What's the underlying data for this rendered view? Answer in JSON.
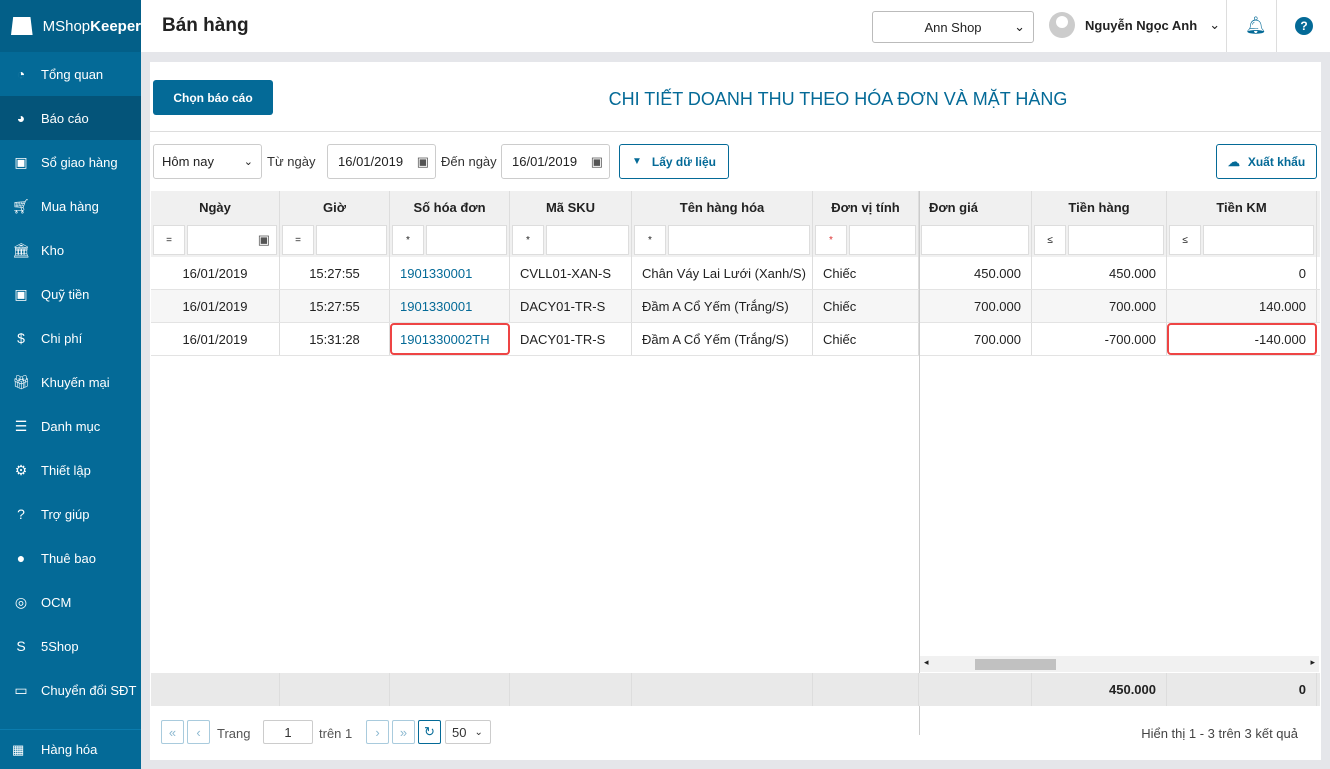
{
  "app": {
    "logo_light": "MShop",
    "logo_bold": "Keeper",
    "page_title": "Bán hàng"
  },
  "sidebar": {
    "items": [
      {
        "label": "Tổng quan",
        "icon": "dashboard-icon"
      },
      {
        "label": "Báo cáo",
        "icon": "pie-chart-icon",
        "active": true
      },
      {
        "label": "Sổ giao hàng",
        "icon": "truck-icon"
      },
      {
        "label": "Mua hàng",
        "icon": "cart-icon"
      },
      {
        "label": "Kho",
        "icon": "warehouse-icon"
      },
      {
        "label": "Quỹ tiền",
        "icon": "safe-icon"
      },
      {
        "label": "Chi phí",
        "icon": "money-icon"
      },
      {
        "label": "Khuyến mại",
        "icon": "gift-icon"
      },
      {
        "label": "Danh mục",
        "icon": "list-icon"
      },
      {
        "label": "Thiết lập",
        "icon": "gear-icon"
      },
      {
        "label": "Trợ giúp",
        "icon": "help-icon"
      },
      {
        "label": "Thuê bao",
        "icon": "user-icon"
      },
      {
        "label": "OCM",
        "icon": "ocm-icon"
      },
      {
        "label": "5Shop",
        "icon": "5shop-icon"
      },
      {
        "label": "Chuyển đổi SĐT",
        "icon": "phone-convert-icon"
      }
    ],
    "bottom": "Hàng hóa"
  },
  "header": {
    "shop": "Ann Shop",
    "user": "Nguyễn Ngọc Anh"
  },
  "report": {
    "choose_label": "Chọn báo cáo",
    "title": "CHI TIẾT DOANH THU THEO HÓA ĐƠN VÀ MẶT HÀNG",
    "period": "Hôm nay",
    "from_label": "Từ ngày",
    "from": "16/01/2019",
    "to_label": "Đến ngày",
    "to": "16/01/2019",
    "fetch_label": "Lấy dữ liệu",
    "export_label": "Xuất khẩu"
  },
  "table": {
    "headers": [
      "Ngày",
      "Giờ",
      "Số hóa đơn",
      "Mã SKU",
      "Tên hàng hóa",
      "Đơn vị tính",
      "Đơn giá",
      "Tiền hàng",
      "Tiền KM"
    ],
    "ops": [
      "=",
      "=",
      "*",
      "*",
      "*",
      "*",
      "",
      "≤",
      "≤"
    ],
    "rows": [
      [
        "16/01/2019",
        "15:27:55",
        "1901330001",
        "CVLL01-XAN-S",
        "Chân Váy Lai Lưới (Xanh/S)",
        "Chiếc",
        "450.000",
        "450.000",
        "0"
      ],
      [
        "16/01/2019",
        "15:27:55",
        "1901330001",
        "DACY01-TR-S",
        "Đầm A Cổ Yếm (Trắng/S)",
        "Chiếc",
        "700.000",
        "700.000",
        "140.000"
      ],
      [
        "16/01/2019",
        "15:31:28",
        "1901330002TH",
        "DACY01-TR-S",
        "Đầm A Cổ Yếm (Trắng/S)",
        "Chiếc",
        "700.000",
        "-700.000",
        "-140.000"
      ]
    ],
    "totals": {
      "tien_hang": "450.000",
      "tien_km": "0"
    }
  },
  "pager": {
    "page_label": "Trang",
    "page": "1",
    "of_label": "trên 1",
    "page_size": "50",
    "summary": "Hiển thị 1 - 3 trên 3 kết quả"
  }
}
